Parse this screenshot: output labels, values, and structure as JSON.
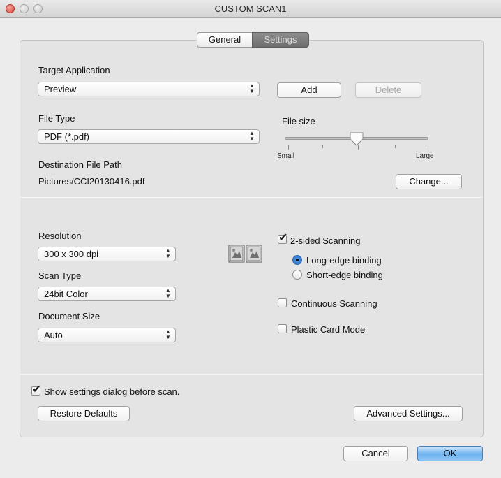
{
  "window": {
    "title": "CUSTOM SCAN1"
  },
  "tabs": [
    {
      "label": "General",
      "selected": false
    },
    {
      "label": "Settings",
      "selected": true
    }
  ],
  "target_application": {
    "label": "Target Application",
    "value": "Preview",
    "add_label": "Add",
    "delete_label": "Delete"
  },
  "file_type": {
    "label": "File Type",
    "value": "PDF (*.pdf)"
  },
  "file_size": {
    "label": "File size",
    "small_label": "Small",
    "large_label": "Large",
    "level": 0.5
  },
  "destination": {
    "label": "Destination File Path",
    "value": "Pictures/CCI20130416.pdf",
    "change_label": "Change..."
  },
  "resolution": {
    "label": "Resolution",
    "value": "300 x 300 dpi"
  },
  "scan_type": {
    "label": "Scan Type",
    "value": "24bit Color"
  },
  "document_size": {
    "label": "Document Size",
    "value": "Auto"
  },
  "two_sided": {
    "label": "2-sided Scanning",
    "checked": true,
    "long_edge_label": "Long-edge binding",
    "short_edge_label": "Short-edge binding",
    "selected": "long"
  },
  "continuous": {
    "label": "Continuous Scanning",
    "checked": false
  },
  "plastic_card": {
    "label": "Plastic Card Mode",
    "checked": false
  },
  "show_dialog": {
    "label": "Show settings dialog before scan.",
    "checked": true
  },
  "buttons": {
    "restore_defaults": "Restore Defaults",
    "advanced_settings": "Advanced Settings...",
    "cancel": "Cancel",
    "ok": "OK"
  },
  "colors": {
    "accent": "#4a90e2",
    "default_button": "#6db3f0"
  },
  "icons": {
    "check": "✔",
    "duplex": "two-page-scan-icon"
  }
}
